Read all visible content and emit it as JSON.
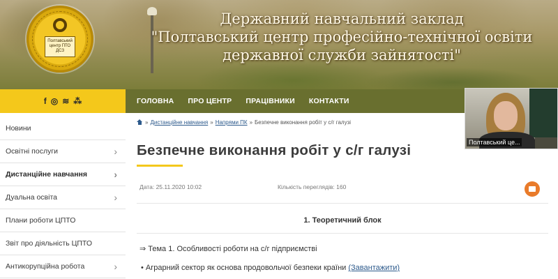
{
  "header": {
    "title_lines": [
      "Державний навчальний заклад",
      "\"Полтавський центр професійно-технічної освіти",
      "державної служби зайнятості\""
    ],
    "logo_text": "Полтавський центр ПТО ДСЗ"
  },
  "social": {
    "icons": [
      "facebook-icon",
      "instagram-icon",
      "rss-icon",
      "sitemap-icon"
    ],
    "glyphs": [
      "f",
      "◎",
      "≋",
      "⁂"
    ]
  },
  "nav": {
    "items": [
      "ГОЛОВНА",
      "ПРО ЦЕНТР",
      "ПРАЦІВНИКИ",
      "КОНТАКТИ"
    ]
  },
  "sidebar": {
    "items": [
      {
        "label": "Новини",
        "has_arrow": false
      },
      {
        "label": "Освітні послуги",
        "has_arrow": true
      },
      {
        "label": "Дистанційне навчання",
        "has_arrow": true,
        "active": true
      },
      {
        "label": "Дуальна освіта",
        "has_arrow": true
      },
      {
        "label": "Плани роботи ЦПТО",
        "has_arrow": false
      },
      {
        "label": "Звіт про діяльність ЦПТО",
        "has_arrow": false
      },
      {
        "label": "Антикорупційна робота",
        "has_arrow": true
      }
    ]
  },
  "breadcrumb": {
    "sep": "»",
    "link1": "Дистанційне навчання",
    "link2": "Напрями ПК",
    "current": "Безпечне виконання робіт у с/г галузі"
  },
  "article": {
    "title": "Безпечне виконання робіт у с/г галузі",
    "date_label": "Дата:",
    "date_value": "25.11.2020 10:02",
    "views_label": "Кількість переглядів:",
    "views_value": "160",
    "block_heading": "1. Теоретичний блок",
    "topic": "⇒ Тема 1. Особливості роботи на с/г підприємстві",
    "bullet_text": "Аграрний сектор як основа продовольчої безпеки країни",
    "bullet_link": "(Завантажити)"
  },
  "video": {
    "caption": "Полтавський це..."
  },
  "colors": {
    "accent_yellow": "#f4c81b",
    "nav_olive": "#696f2f",
    "print_orange": "#e97b2a",
    "link_blue": "#2d5a8c"
  }
}
